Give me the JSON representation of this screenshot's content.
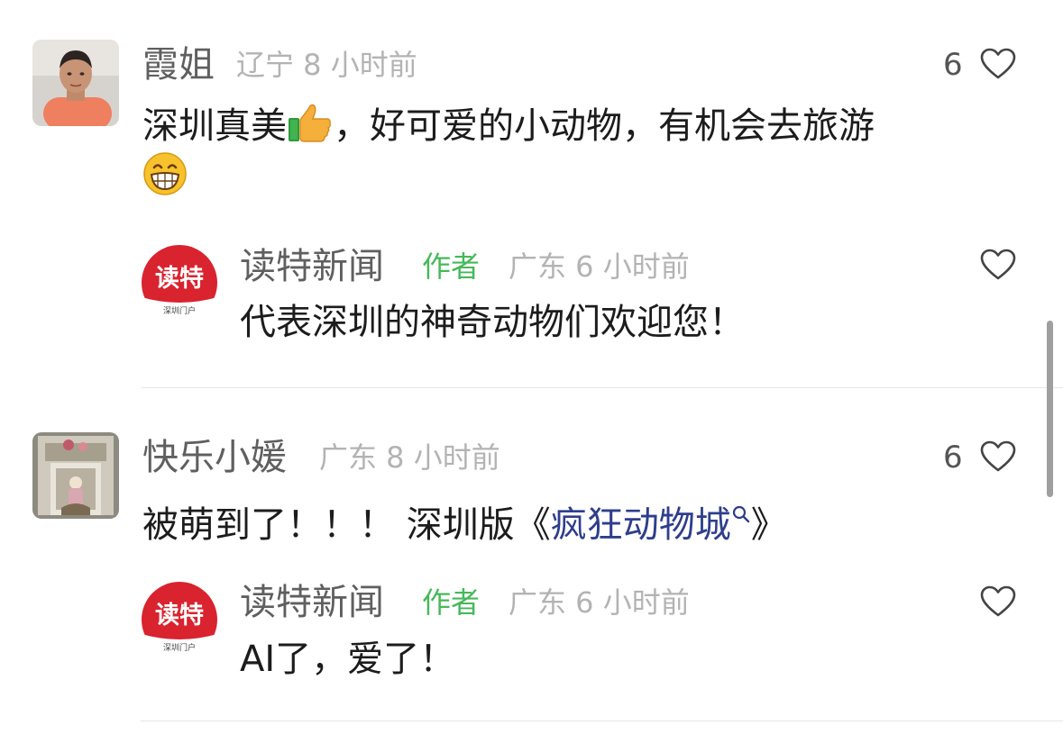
{
  "comments": [
    {
      "user_name": "霞姐",
      "meta": "辽宁 8 小时前",
      "text_part1": "深圳真美",
      "emoji_1": "thumbs-up-icon",
      "text_part2": "，好可爱的小动物，有机会去旅游",
      "emoji_2": "grinning-face-icon",
      "like_count": "6",
      "reply": {
        "user_name": "读特新闻",
        "author_tag": "作者",
        "meta": "广东 6 小时前",
        "text": "代表深圳的神奇动物们欢迎您！"
      }
    },
    {
      "user_name": "快乐小媛",
      "meta": "广东 8 小时前",
      "text_part1": "被萌到了！！！ 深圳版《",
      "link_text": "疯狂动物城",
      "link_icon": "search-icon",
      "text_part2": "》",
      "like_count": "6",
      "reply": {
        "user_name": "读特新闻",
        "author_tag": "作者",
        "meta": "广东 6 小时前",
        "text": "AI了，爱了！"
      }
    }
  ],
  "brand_logo": {
    "main": "读特",
    "sub": "深圳门户"
  },
  "colors": {
    "author_tag": "#46b85a",
    "link": "#2e3e8c",
    "brand_red": "#d9232f"
  }
}
